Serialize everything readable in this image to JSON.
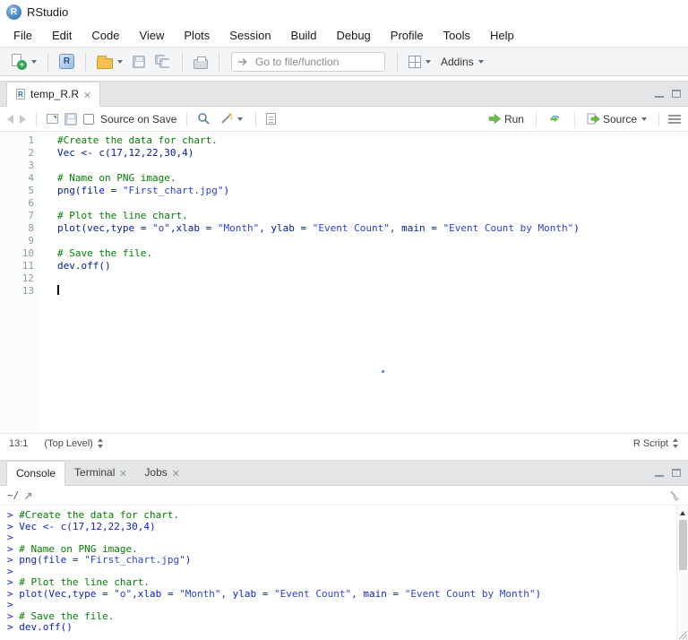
{
  "window": {
    "title": "RStudio",
    "logo_letter": "R"
  },
  "menu": {
    "items": [
      "File",
      "Edit",
      "Code",
      "View",
      "Plots",
      "Session",
      "Build",
      "Debug",
      "Profile",
      "Tools",
      "Help"
    ]
  },
  "main_toolbar": {
    "goto_placeholder": "Go to file/function",
    "addins_label": "Addins"
  },
  "source_pane": {
    "tab_title": "temp_R.R",
    "toolbar": {
      "source_on_save_label": "Source on Save",
      "run_label": "Run",
      "source_label": "Source"
    },
    "cursor_line": 13,
    "code_lines": [
      [
        {
          "t": "#Create the data for chart.",
          "k": "comment"
        }
      ],
      [
        {
          "t": "Vec <- c(17,12,22,30,4)",
          "k": "code"
        }
      ],
      [],
      [
        {
          "t": "# Name on PNG image.",
          "k": "comment"
        }
      ],
      [
        {
          "t": "png(file = ",
          "k": "code"
        },
        {
          "t": "\"First_chart.jpg\"",
          "k": "string"
        },
        {
          "t": ")",
          "k": "code"
        }
      ],
      [],
      [
        {
          "t": "# Plot the line chart.",
          "k": "comment"
        }
      ],
      [
        {
          "t": "plot(vec,type = ",
          "k": "code"
        },
        {
          "t": "\"o\"",
          "k": "string"
        },
        {
          "t": ",xlab = ",
          "k": "code"
        },
        {
          "t": "\"Month\"",
          "k": "string"
        },
        {
          "t": ", ylab = ",
          "k": "code"
        },
        {
          "t": "\"Event Count\"",
          "k": "string"
        },
        {
          "t": ", main = ",
          "k": "code"
        },
        {
          "t": "\"Event Count by Month\"",
          "k": "string"
        },
        {
          "t": ")",
          "k": "code"
        }
      ],
      [],
      [
        {
          "t": "# Save the file.",
          "k": "comment"
        }
      ],
      [
        {
          "t": "dev.off()",
          "k": "code"
        }
      ],
      [],
      []
    ],
    "status": {
      "cursor_position": "13:1",
      "scope": "(Top Level)",
      "file_type": "R Script"
    }
  },
  "console_pane": {
    "tabs": [
      "Console",
      "Terminal",
      "Jobs"
    ],
    "working_dir": "~/",
    "lines": [
      [
        {
          "t": "> ",
          "k": "prompt"
        },
        {
          "t": "#Create the data for chart.",
          "k": "comment"
        }
      ],
      [
        {
          "t": "> ",
          "k": "prompt"
        },
        {
          "t": "Vec <- c(17,12,22,30,4)",
          "k": "code"
        }
      ],
      [
        {
          "t": "> ",
          "k": "prompt"
        }
      ],
      [
        {
          "t": "> ",
          "k": "prompt"
        },
        {
          "t": "# Name on PNG image.",
          "k": "comment"
        }
      ],
      [
        {
          "t": "> ",
          "k": "prompt"
        },
        {
          "t": "png(file = ",
          "k": "code"
        },
        {
          "t": "\"First_chart.jpg\"",
          "k": "string"
        },
        {
          "t": ")",
          "k": "code"
        }
      ],
      [
        {
          "t": "> ",
          "k": "prompt"
        }
      ],
      [
        {
          "t": "> ",
          "k": "prompt"
        },
        {
          "t": "# Plot the line chart.",
          "k": "comment"
        }
      ],
      [
        {
          "t": "> ",
          "k": "prompt"
        },
        {
          "t": "plot(Vec,type = ",
          "k": "code"
        },
        {
          "t": "\"o\"",
          "k": "string"
        },
        {
          "t": ",xlab = ",
          "k": "code"
        },
        {
          "t": "\"Month\"",
          "k": "string"
        },
        {
          "t": ", ylab = ",
          "k": "code"
        },
        {
          "t": "\"Event Count\"",
          "k": "string"
        },
        {
          "t": ", main = ",
          "k": "code"
        },
        {
          "t": "\"Event Count by Month\"",
          "k": "string"
        },
        {
          "t": ")",
          "k": "code"
        }
      ],
      [
        {
          "t": "> ",
          "k": "prompt"
        }
      ],
      [
        {
          "t": "> ",
          "k": "prompt"
        },
        {
          "t": "# Save the file.",
          "k": "comment"
        }
      ],
      [
        {
          "t": "> ",
          "k": "prompt"
        },
        {
          "t": "dev.off()",
          "k": "code"
        }
      ]
    ]
  },
  "colors": {
    "comment_green": "#008000",
    "editor_code_blue": "#001b9e",
    "string_blue": "#2a43d6",
    "console_blue": "#0f23cc",
    "run_green": "#6dbb4a"
  }
}
